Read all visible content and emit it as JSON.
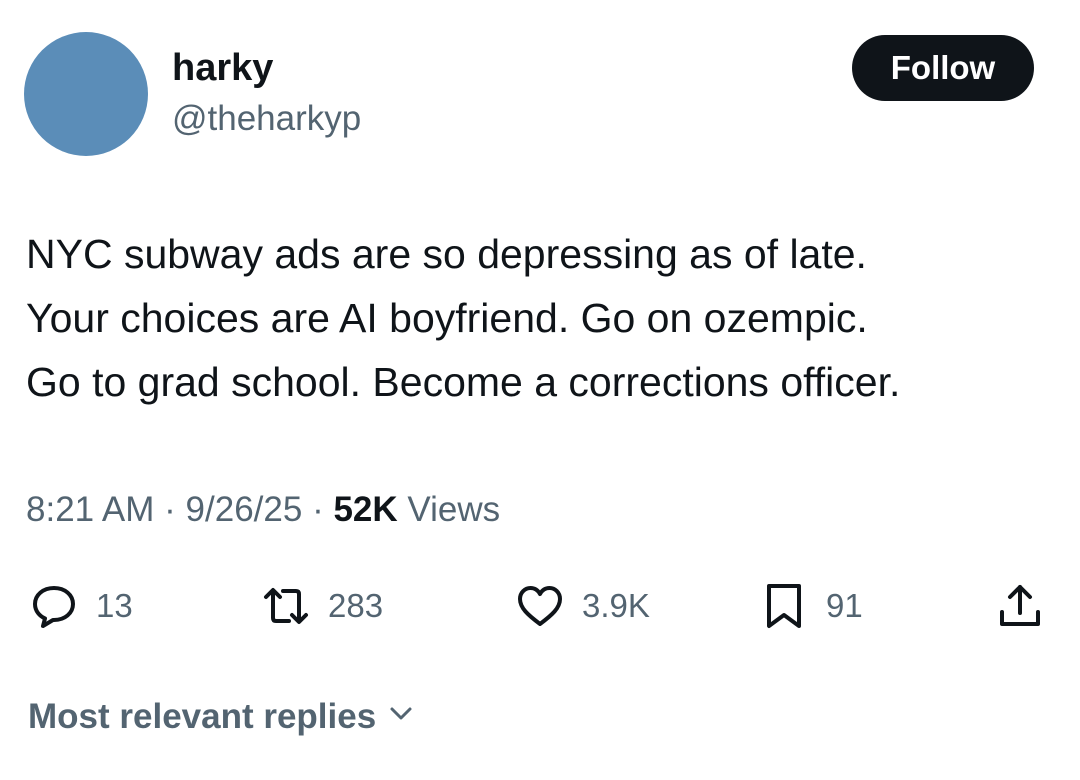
{
  "colors": {
    "avatar": "#5b8db8",
    "follow_bg": "#0f1419",
    "follow_text": "#ffffff",
    "secondary_text": "#536471",
    "primary_text": "#0f1419"
  },
  "author": {
    "display_name": "harky",
    "handle": "@theharkyp",
    "follow_label": "Follow"
  },
  "tweet": {
    "lines": [
      "NYC subway ads are so depressing as of late.",
      "Your choices are AI boyfriend. Go on ozempic.",
      "Go to grad school. Become a corrections officer."
    ],
    "time": "8:21 AM",
    "separator": "·",
    "date": "9/26/25",
    "views_count": "52K",
    "views_label": "Views"
  },
  "actions": [
    {
      "icon": "reply-icon",
      "count": "13"
    },
    {
      "icon": "repost-icon",
      "count": "283"
    },
    {
      "icon": "heart-icon",
      "count": "3.9K"
    },
    {
      "icon": "bookmark-icon",
      "count": "91"
    },
    {
      "icon": "share-icon",
      "count": ""
    }
  ],
  "replies": {
    "sort_label": "Most relevant replies",
    "sort_icon": "chevron-down-icon"
  }
}
